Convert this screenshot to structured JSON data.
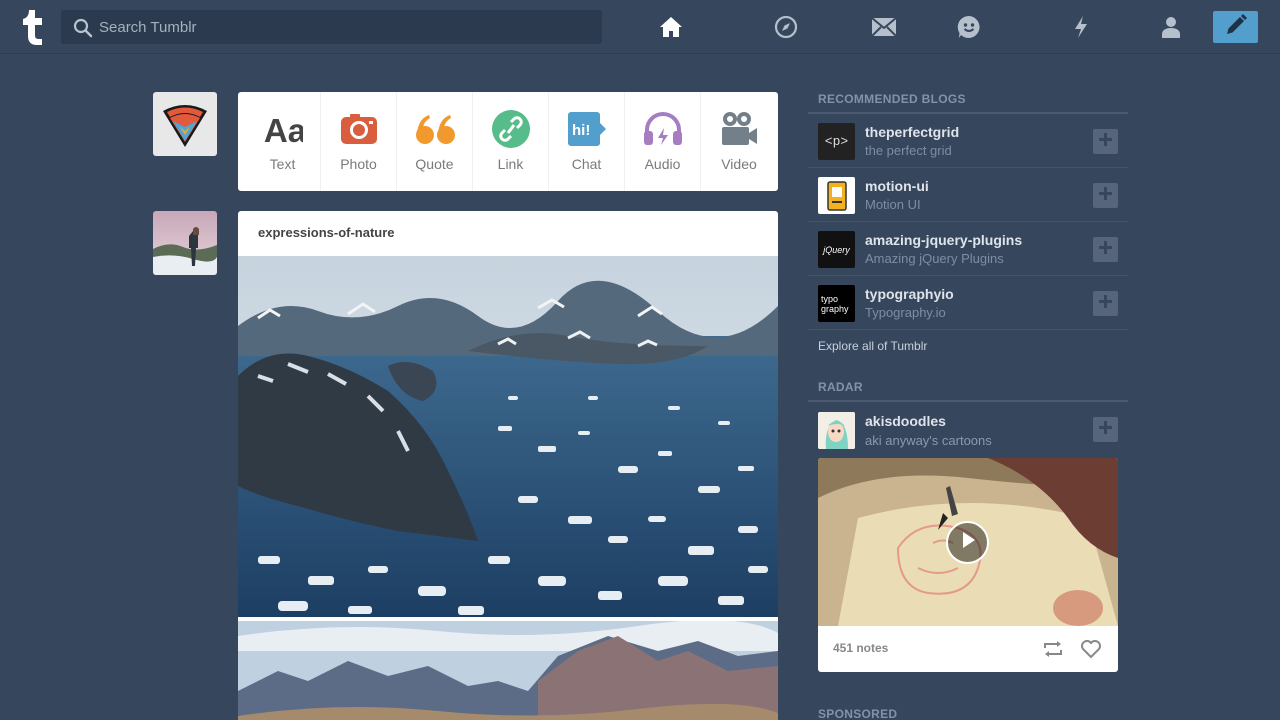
{
  "header": {
    "search_placeholder": "Search Tumblr",
    "nav": [
      "home-icon",
      "explore-compass-icon",
      "inbox-mail-icon",
      "messaging-smiley-icon",
      "activity-lightning-icon",
      "account-person-icon"
    ],
    "compose_icon": "pencil-icon",
    "accent": "#529ecc"
  },
  "post_types": [
    {
      "label": "Text",
      "icon": "text-aa-icon",
      "color": "#444444"
    },
    {
      "label": "Photo",
      "icon": "camera-icon",
      "color": "#d95e40"
    },
    {
      "label": "Quote",
      "icon": "quote-icon",
      "color": "#f2992e"
    },
    {
      "label": "Link",
      "icon": "link-icon",
      "color": "#56bc8a"
    },
    {
      "label": "Chat",
      "icon": "chat-hi-icon",
      "color": "#529ecc"
    },
    {
      "label": "Audio",
      "icon": "headphones-icon",
      "color": "#a77dc2"
    },
    {
      "label": "Video",
      "icon": "video-camera-icon",
      "color": "#748089"
    }
  ],
  "post": {
    "blog_name": "expressions-of-nature"
  },
  "sidebar": {
    "recommended_title": "RECOMMENDED BLOGS",
    "blogs": [
      {
        "name": "theperfectgrid",
        "title": "the perfect grid",
        "avatar_text": "<p>"
      },
      {
        "name": "motion-ui",
        "title": "Motion UI",
        "avatar_text": ""
      },
      {
        "name": "amazing-jquery-plugins",
        "title": "Amazing jQuery Plugins",
        "avatar_text": "jQuery"
      },
      {
        "name": "typographyio",
        "title": "Typography.io",
        "avatar_text": "typo graphy"
      }
    ],
    "explore_label": "Explore all of Tumblr",
    "radar_title": "RADAR",
    "radar": {
      "name": "akisdoodles",
      "title": "aki anyway's cartoons",
      "notes": "451 notes"
    },
    "sponsored_title": "SPONSORED"
  }
}
